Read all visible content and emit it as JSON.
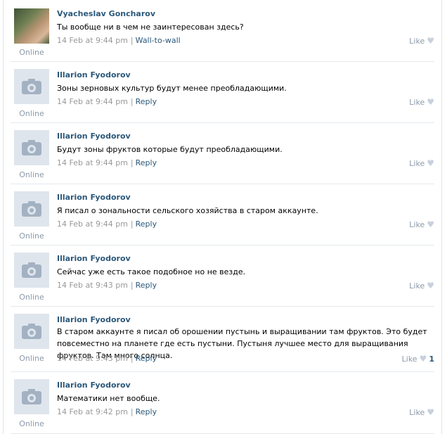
{
  "posts": [
    {
      "author": "Vyacheslav Goncharov",
      "text": "Ты вообще ни в чем не заинтересован здесь?",
      "time": "14 Feb at 9:44 pm",
      "action": "Wall-to-wall",
      "like": "Like",
      "like_count": "",
      "online": "Online",
      "avatar": "photo"
    },
    {
      "author": "Illarion Fyodorov",
      "text": "Зоны зерновых культур будут менее преобладающими.",
      "time": "14 Feb at 9:44 pm",
      "action": "Reply",
      "like": "Like",
      "like_count": "",
      "online": "Online",
      "avatar": "camera-placeholder"
    },
    {
      "author": "Illarion Fyodorov",
      "text": "Будут зоны фруктов которые будут преобладающими.",
      "time": "14 Feb at 9:44 pm",
      "action": "Reply",
      "like": "Like",
      "like_count": "",
      "online": "Online",
      "avatar": "camera-placeholder"
    },
    {
      "author": "Illarion Fyodorov",
      "text": "Я писал о зональности сельского хозяйства в старом аккаунте.",
      "time": "14 Feb at 9:44 pm",
      "action": "Reply",
      "like": "Like",
      "like_count": "",
      "online": "Online",
      "avatar": "camera-placeholder"
    },
    {
      "author": "Illarion Fyodorov",
      "text": "Сейчас уже есть такое подобное но не везде.",
      "time": "14 Feb at 9:43 pm",
      "action": "Reply",
      "like": "Like",
      "like_count": "",
      "online": "Online",
      "avatar": "camera-placeholder"
    },
    {
      "author": "Illarion Fyodorov",
      "text": "В старом аккаунте я писал об орошении пустынь и выращивании там фруктов. Это будет повсеместно на планете где есть пустыни. Пустыня лучшее место для выращивания фруктов. Там много солнца.",
      "time": "14 Feb at 9:43 pm",
      "action": "Reply",
      "like": "Like",
      "like_count": "1",
      "online": "Online",
      "avatar": "camera-placeholder"
    },
    {
      "author": "Illarion Fyodorov",
      "text": "Математики нет вообще.",
      "time": "14 Feb at 9:42 pm",
      "action": "Reply",
      "like": "Like",
      "like_count": "",
      "online": "Online",
      "avatar": "camera-placeholder"
    }
  ],
  "colors": {
    "link": "#2b587a",
    "muted": "#999999",
    "placeholder_bg": "#dfe5ec",
    "heart": "#c7d1dc"
  }
}
